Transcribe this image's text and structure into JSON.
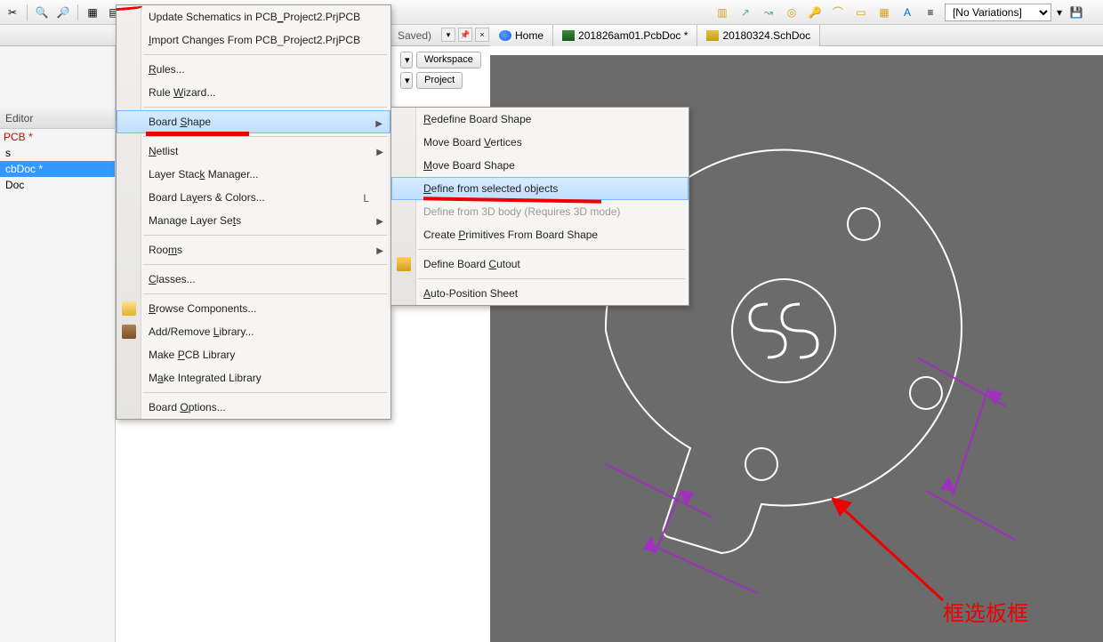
{
  "toolbar": {
    "saved_suffix": "Saved)",
    "variations_label": "[No Variations]"
  },
  "tabs": {
    "home": "Home",
    "pcb": "201826am01.PcbDoc *",
    "sch": "20180324.SchDoc"
  },
  "left": {
    "editor_label": "Editor",
    "project_label": "PCB *",
    "files": [
      {
        "name": "s"
      },
      {
        "name": "cbDoc *"
      },
      {
        "name": "Doc"
      }
    ]
  },
  "buttons": {
    "workspace": "Workspace",
    "project": "Project"
  },
  "menu_main": [
    {
      "label_pre": "Update Schematics in PCB",
      "label_u": "_",
      "label_post": "Project2.PrjPCB"
    },
    {
      "label_pre": "",
      "label_u": "I",
      "label_post": "mport Changes From PCB_Project2.PrjPCB"
    },
    {
      "sep": true
    },
    {
      "label_pre": "",
      "label_u": "R",
      "label_post": "ules..."
    },
    {
      "label_pre": "Rule ",
      "label_u": "W",
      "label_post": "izard..."
    },
    {
      "sep": true
    },
    {
      "label_pre": "Board ",
      "label_u": "S",
      "label_post": "hape",
      "arrow": true,
      "hover": true
    },
    {
      "sep": true
    },
    {
      "label_pre": "",
      "label_u": "N",
      "label_post": "etlist",
      "arrow": true
    },
    {
      "label_pre": "Layer Stac",
      "label_u": "k",
      "label_post": " Manager..."
    },
    {
      "label_pre": "Board La",
      "label_u": "y",
      "label_post": "ers & Colors...",
      "shortcut": "L"
    },
    {
      "label_pre": "Manage Layer Se",
      "label_u": "t",
      "label_post": "s",
      "arrow": true
    },
    {
      "sep": true
    },
    {
      "label_pre": "Roo",
      "label_u": "m",
      "label_post": "s",
      "arrow": true
    },
    {
      "sep": true
    },
    {
      "label_pre": "",
      "label_u": "C",
      "label_post": "lasses..."
    },
    {
      "sep": true
    },
    {
      "label_pre": "",
      "label_u": "B",
      "label_post": "rowse Components...",
      "icon": "mico-browse"
    },
    {
      "label_pre": "Add/Remove ",
      "label_u": "L",
      "label_post": "ibrary...",
      "icon": "mico-lib"
    },
    {
      "label_pre": "Make ",
      "label_u": "P",
      "label_post": "CB Library"
    },
    {
      "label_pre": "M",
      "label_u": "a",
      "label_post": "ke Integrated Library"
    },
    {
      "sep": true
    },
    {
      "label_pre": "Board ",
      "label_u": "O",
      "label_post": "ptions..."
    }
  ],
  "menu_sub": [
    {
      "label_pre": "",
      "label_u": "R",
      "label_post": "edefine Board Shape"
    },
    {
      "label_pre": "Move Board ",
      "label_u": "V",
      "label_post": "ertices"
    },
    {
      "label_pre": "",
      "label_u": "M",
      "label_post": "ove Board Shape"
    },
    {
      "label_pre": "",
      "label_u": "D",
      "label_post": "efine from selected objects",
      "hover": true
    },
    {
      "label_pre": "Define from 3D body (Requires 3D mode)",
      "label_u": "",
      "label_post": "",
      "disabled": true
    },
    {
      "label_pre": "Create ",
      "label_u": "P",
      "label_post": "rimitives From Board Shape"
    },
    {
      "sep": true
    },
    {
      "label_pre": "Define Board ",
      "label_u": "C",
      "label_post": "utout",
      "icon": "mico-def"
    },
    {
      "sep": true
    },
    {
      "label_pre": "",
      "label_u": "A",
      "label_post": "uto-Position Sheet"
    }
  ],
  "annotation": "框选板框"
}
